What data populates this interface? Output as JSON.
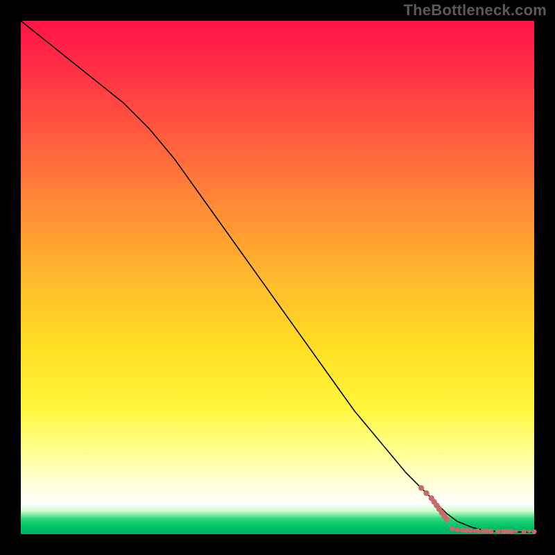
{
  "watermark": "TheBottleneck.com",
  "colors": {
    "point": "#c86a6a",
    "curve": "#000000"
  },
  "chart_data": {
    "type": "line",
    "title": "",
    "xlabel": "",
    "ylabel": "",
    "xlim": [
      0,
      100
    ],
    "ylim": [
      0,
      100
    ],
    "grid": false,
    "legend": false,
    "series": [
      {
        "name": "curve",
        "style": "line",
        "x": [
          0,
          5,
          10,
          15,
          20,
          25,
          30,
          35,
          40,
          45,
          50,
          55,
          60,
          65,
          70,
          75,
          80,
          83,
          85,
          88,
          90,
          92,
          94,
          96,
          98,
          100
        ],
        "y": [
          100,
          96,
          92,
          88,
          84,
          79,
          73,
          66,
          59,
          52,
          45,
          38,
          31,
          24,
          18,
          12,
          7,
          4,
          2.5,
          1.3,
          0.8,
          0.6,
          0.5,
          0.45,
          0.42,
          0.4
        ]
      },
      {
        "name": "points-on-slope",
        "style": "scatter",
        "x": [
          78,
          79,
          80,
          80.5,
          81,
          81.5,
          82,
          82.5,
          83
        ],
        "y": [
          9.0,
          8.0,
          7.0,
          6.3,
          5.6,
          4.9,
          4.2,
          3.5,
          2.9
        ]
      },
      {
        "name": "points-bottom",
        "style": "scatter",
        "x": [
          84,
          85,
          86,
          86.8,
          87.6,
          89,
          90,
          90.8,
          91.6,
          93,
          94,
          94.8,
          95.6,
          98,
          100
        ],
        "y": [
          1.1,
          0.9,
          0.8,
          0.75,
          0.72,
          0.65,
          0.62,
          0.6,
          0.58,
          0.55,
          0.54,
          0.53,
          0.52,
          0.5,
          0.48
        ]
      },
      {
        "name": "dashes-bottom",
        "style": "dash",
        "x_pairs": [
          [
            86.0,
            86.9
          ],
          [
            88.0,
            88.9
          ],
          [
            91.0,
            91.9
          ],
          [
            92.4,
            93.3
          ],
          [
            94.4,
            95.3
          ],
          [
            96.0,
            96.9
          ],
          [
            98.6,
            99.5
          ]
        ],
        "y": 0.62
      }
    ]
  }
}
